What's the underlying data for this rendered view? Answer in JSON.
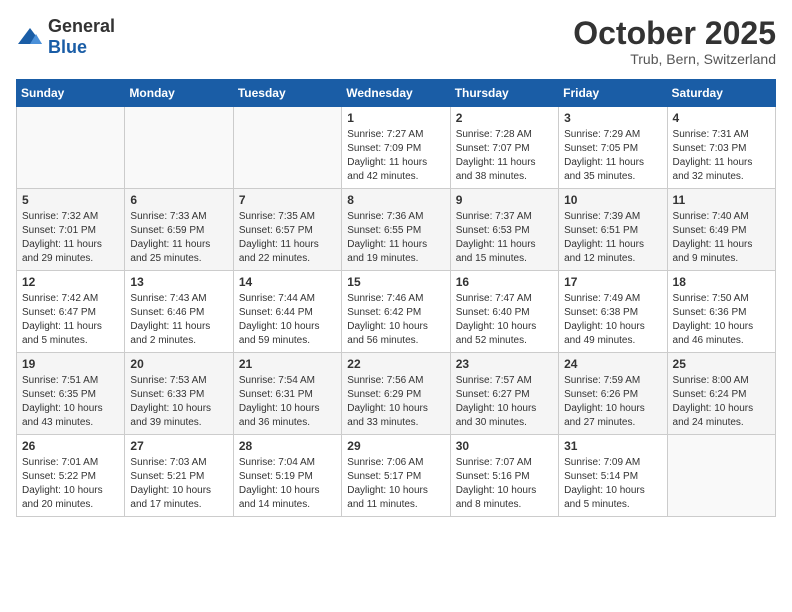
{
  "header": {
    "logo_general": "General",
    "logo_blue": "Blue",
    "month": "October 2025",
    "location": "Trub, Bern, Switzerland"
  },
  "weekdays": [
    "Sunday",
    "Monday",
    "Tuesday",
    "Wednesday",
    "Thursday",
    "Friday",
    "Saturday"
  ],
  "weeks": [
    [
      {
        "day": "",
        "sunrise": "",
        "sunset": "",
        "daylight": ""
      },
      {
        "day": "",
        "sunrise": "",
        "sunset": "",
        "daylight": ""
      },
      {
        "day": "",
        "sunrise": "",
        "sunset": "",
        "daylight": ""
      },
      {
        "day": "1",
        "sunrise": "Sunrise: 7:27 AM",
        "sunset": "Sunset: 7:09 PM",
        "daylight": "Daylight: 11 hours and 42 minutes."
      },
      {
        "day": "2",
        "sunrise": "Sunrise: 7:28 AM",
        "sunset": "Sunset: 7:07 PM",
        "daylight": "Daylight: 11 hours and 38 minutes."
      },
      {
        "day": "3",
        "sunrise": "Sunrise: 7:29 AM",
        "sunset": "Sunset: 7:05 PM",
        "daylight": "Daylight: 11 hours and 35 minutes."
      },
      {
        "day": "4",
        "sunrise": "Sunrise: 7:31 AM",
        "sunset": "Sunset: 7:03 PM",
        "daylight": "Daylight: 11 hours and 32 minutes."
      }
    ],
    [
      {
        "day": "5",
        "sunrise": "Sunrise: 7:32 AM",
        "sunset": "Sunset: 7:01 PM",
        "daylight": "Daylight: 11 hours and 29 minutes."
      },
      {
        "day": "6",
        "sunrise": "Sunrise: 7:33 AM",
        "sunset": "Sunset: 6:59 PM",
        "daylight": "Daylight: 11 hours and 25 minutes."
      },
      {
        "day": "7",
        "sunrise": "Sunrise: 7:35 AM",
        "sunset": "Sunset: 6:57 PM",
        "daylight": "Daylight: 11 hours and 22 minutes."
      },
      {
        "day": "8",
        "sunrise": "Sunrise: 7:36 AM",
        "sunset": "Sunset: 6:55 PM",
        "daylight": "Daylight: 11 hours and 19 minutes."
      },
      {
        "day": "9",
        "sunrise": "Sunrise: 7:37 AM",
        "sunset": "Sunset: 6:53 PM",
        "daylight": "Daylight: 11 hours and 15 minutes."
      },
      {
        "day": "10",
        "sunrise": "Sunrise: 7:39 AM",
        "sunset": "Sunset: 6:51 PM",
        "daylight": "Daylight: 11 hours and 12 minutes."
      },
      {
        "day": "11",
        "sunrise": "Sunrise: 7:40 AM",
        "sunset": "Sunset: 6:49 PM",
        "daylight": "Daylight: 11 hours and 9 minutes."
      }
    ],
    [
      {
        "day": "12",
        "sunrise": "Sunrise: 7:42 AM",
        "sunset": "Sunset: 6:47 PM",
        "daylight": "Daylight: 11 hours and 5 minutes."
      },
      {
        "day": "13",
        "sunrise": "Sunrise: 7:43 AM",
        "sunset": "Sunset: 6:46 PM",
        "daylight": "Daylight: 11 hours and 2 minutes."
      },
      {
        "day": "14",
        "sunrise": "Sunrise: 7:44 AM",
        "sunset": "Sunset: 6:44 PM",
        "daylight": "Daylight: 10 hours and 59 minutes."
      },
      {
        "day": "15",
        "sunrise": "Sunrise: 7:46 AM",
        "sunset": "Sunset: 6:42 PM",
        "daylight": "Daylight: 10 hours and 56 minutes."
      },
      {
        "day": "16",
        "sunrise": "Sunrise: 7:47 AM",
        "sunset": "Sunset: 6:40 PM",
        "daylight": "Daylight: 10 hours and 52 minutes."
      },
      {
        "day": "17",
        "sunrise": "Sunrise: 7:49 AM",
        "sunset": "Sunset: 6:38 PM",
        "daylight": "Daylight: 10 hours and 49 minutes."
      },
      {
        "day": "18",
        "sunrise": "Sunrise: 7:50 AM",
        "sunset": "Sunset: 6:36 PM",
        "daylight": "Daylight: 10 hours and 46 minutes."
      }
    ],
    [
      {
        "day": "19",
        "sunrise": "Sunrise: 7:51 AM",
        "sunset": "Sunset: 6:35 PM",
        "daylight": "Daylight: 10 hours and 43 minutes."
      },
      {
        "day": "20",
        "sunrise": "Sunrise: 7:53 AM",
        "sunset": "Sunset: 6:33 PM",
        "daylight": "Daylight: 10 hours and 39 minutes."
      },
      {
        "day": "21",
        "sunrise": "Sunrise: 7:54 AM",
        "sunset": "Sunset: 6:31 PM",
        "daylight": "Daylight: 10 hours and 36 minutes."
      },
      {
        "day": "22",
        "sunrise": "Sunrise: 7:56 AM",
        "sunset": "Sunset: 6:29 PM",
        "daylight": "Daylight: 10 hours and 33 minutes."
      },
      {
        "day": "23",
        "sunrise": "Sunrise: 7:57 AM",
        "sunset": "Sunset: 6:27 PM",
        "daylight": "Daylight: 10 hours and 30 minutes."
      },
      {
        "day": "24",
        "sunrise": "Sunrise: 7:59 AM",
        "sunset": "Sunset: 6:26 PM",
        "daylight": "Daylight: 10 hours and 27 minutes."
      },
      {
        "day": "25",
        "sunrise": "Sunrise: 8:00 AM",
        "sunset": "Sunset: 6:24 PM",
        "daylight": "Daylight: 10 hours and 24 minutes."
      }
    ],
    [
      {
        "day": "26",
        "sunrise": "Sunrise: 7:01 AM",
        "sunset": "Sunset: 5:22 PM",
        "daylight": "Daylight: 10 hours and 20 minutes."
      },
      {
        "day": "27",
        "sunrise": "Sunrise: 7:03 AM",
        "sunset": "Sunset: 5:21 PM",
        "daylight": "Daylight: 10 hours and 17 minutes."
      },
      {
        "day": "28",
        "sunrise": "Sunrise: 7:04 AM",
        "sunset": "Sunset: 5:19 PM",
        "daylight": "Daylight: 10 hours and 14 minutes."
      },
      {
        "day": "29",
        "sunrise": "Sunrise: 7:06 AM",
        "sunset": "Sunset: 5:17 PM",
        "daylight": "Daylight: 10 hours and 11 minutes."
      },
      {
        "day": "30",
        "sunrise": "Sunrise: 7:07 AM",
        "sunset": "Sunset: 5:16 PM",
        "daylight": "Daylight: 10 hours and 8 minutes."
      },
      {
        "day": "31",
        "sunrise": "Sunrise: 7:09 AM",
        "sunset": "Sunset: 5:14 PM",
        "daylight": "Daylight: 10 hours and 5 minutes."
      },
      {
        "day": "",
        "sunrise": "",
        "sunset": "",
        "daylight": ""
      }
    ]
  ]
}
